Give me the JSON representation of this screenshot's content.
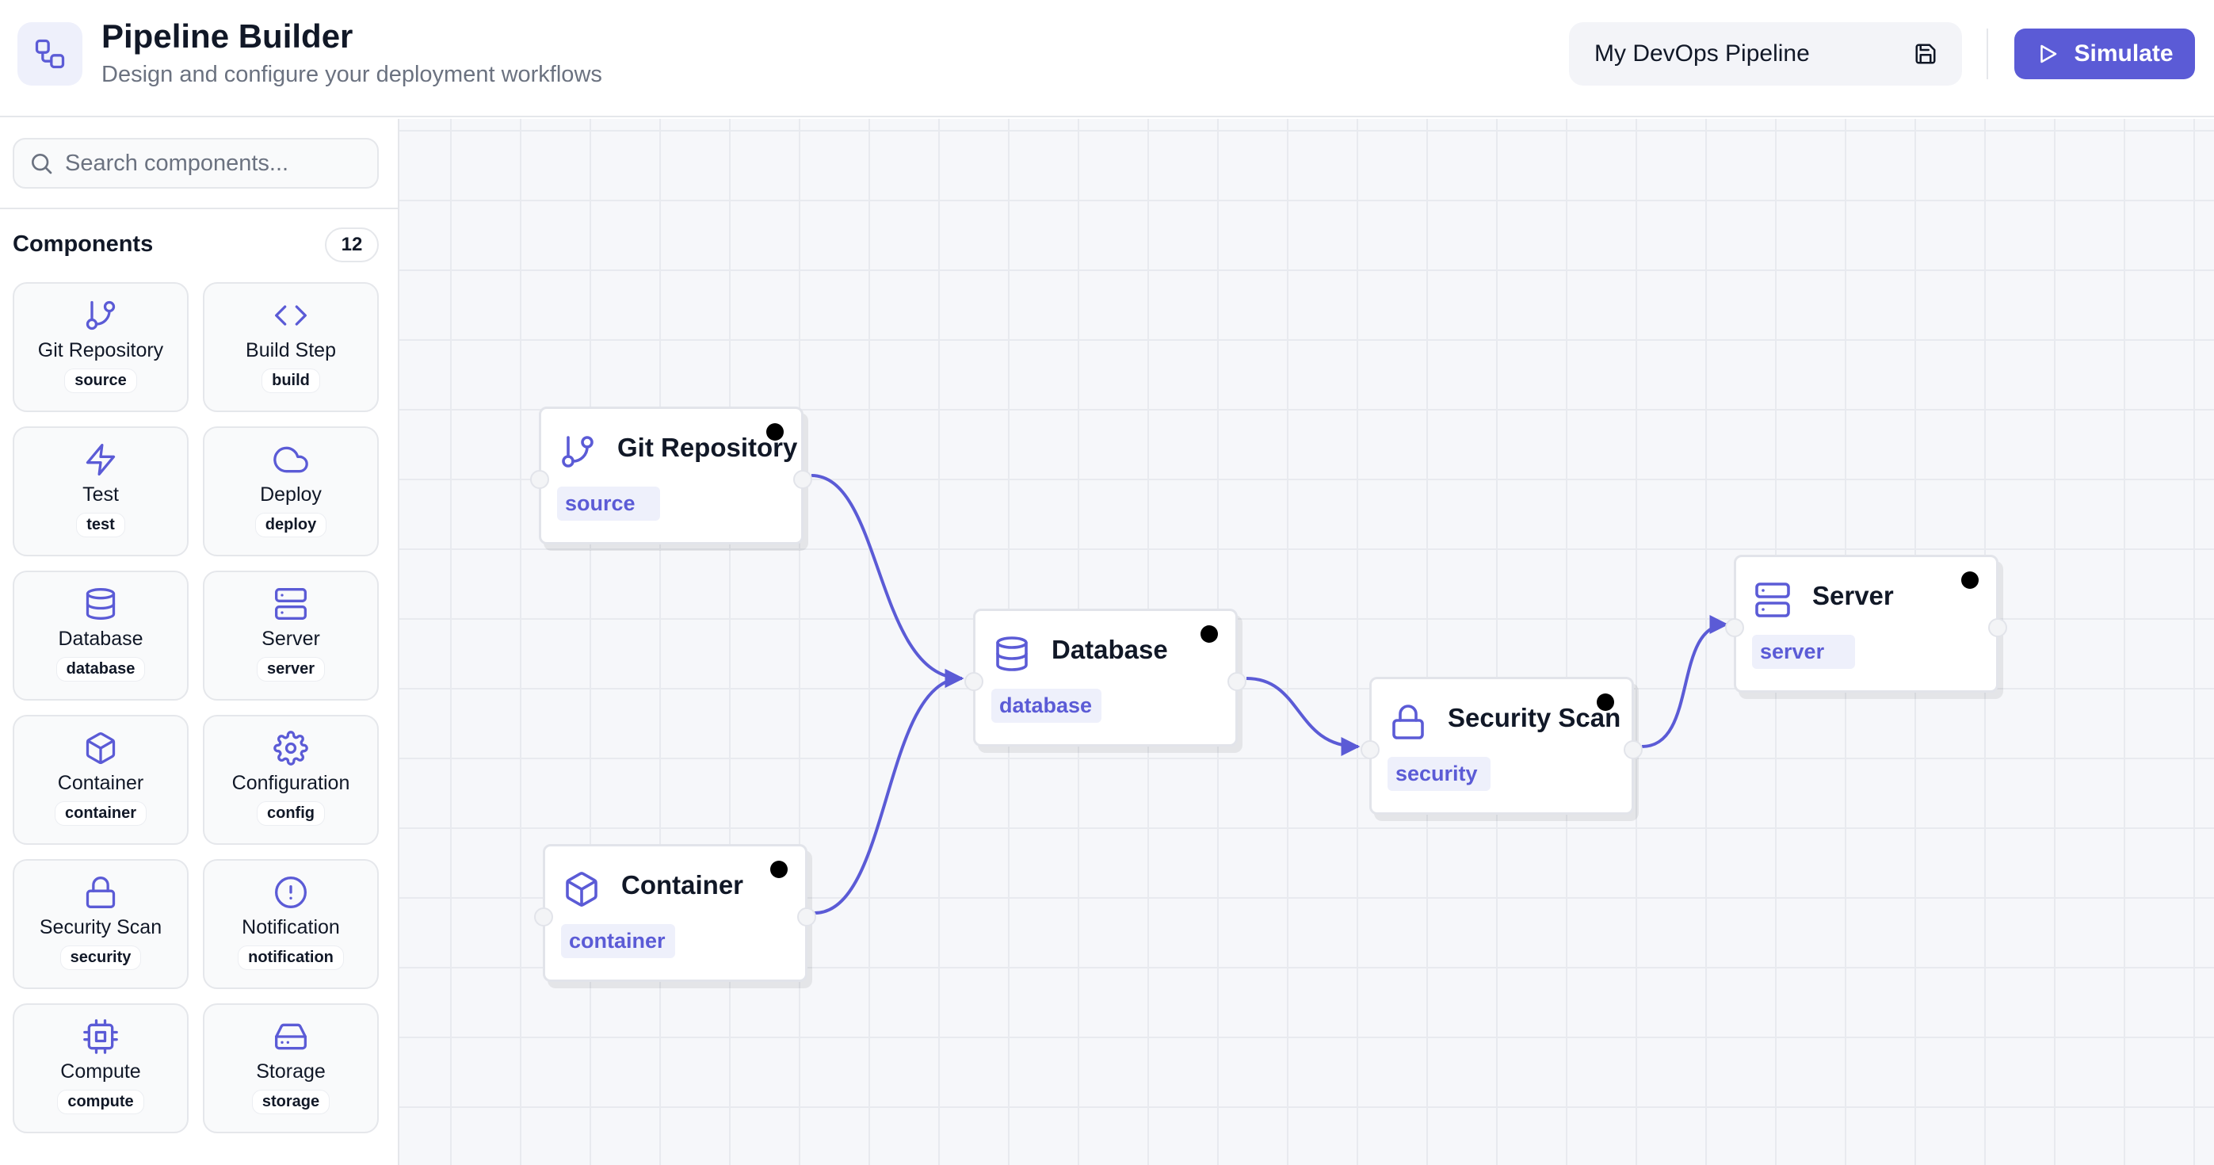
{
  "header": {
    "title": "Pipeline Builder",
    "subtitle": "Design and configure your deployment workflows",
    "pipeline_name": "My DevOps Pipeline",
    "save_icon": "save-icon",
    "simulate_label": "Simulate",
    "logo_icon": "workflow-icon",
    "accent": "#5b5bd6"
  },
  "sidebar": {
    "search_placeholder": "Search components...",
    "components_title": "Components",
    "components_count": "12",
    "components": [
      {
        "name": "Git Repository",
        "tag": "source",
        "icon": "git-branch-icon"
      },
      {
        "name": "Build Step",
        "tag": "build",
        "icon": "code-icon"
      },
      {
        "name": "Test",
        "tag": "test",
        "icon": "zap-icon"
      },
      {
        "name": "Deploy",
        "tag": "deploy",
        "icon": "cloud-icon"
      },
      {
        "name": "Database",
        "tag": "database",
        "icon": "database-icon"
      },
      {
        "name": "Server",
        "tag": "server",
        "icon": "server-icon"
      },
      {
        "name": "Container",
        "tag": "container",
        "icon": "box-icon"
      },
      {
        "name": "Configuration",
        "tag": "config",
        "icon": "gear-icon"
      },
      {
        "name": "Security Scan",
        "tag": "security",
        "icon": "lock-icon"
      },
      {
        "name": "Notification",
        "tag": "notification",
        "icon": "alert-circle-icon"
      },
      {
        "name": "Compute",
        "tag": "compute",
        "icon": "cpu-icon"
      },
      {
        "name": "Storage",
        "tag": "storage",
        "icon": "hard-drive-icon"
      }
    ]
  },
  "canvas": {
    "nodes": [
      {
        "id": "git",
        "title": "Git Repository",
        "tag": "source",
        "icon": "git-branch-icon"
      },
      {
        "id": "container",
        "title": "Container",
        "tag": "container",
        "icon": "box-icon"
      },
      {
        "id": "database",
        "title": "Database",
        "tag": "database",
        "icon": "database-icon"
      },
      {
        "id": "security",
        "title": "Security Scan",
        "tag": "security",
        "icon": "lock-icon"
      },
      {
        "id": "server",
        "title": "Server",
        "tag": "server",
        "icon": "server-icon"
      }
    ],
    "edges": [
      {
        "from": "git",
        "to": "database"
      },
      {
        "from": "container",
        "to": "database"
      },
      {
        "from": "database",
        "to": "security"
      },
      {
        "from": "security",
        "to": "server"
      }
    ]
  }
}
